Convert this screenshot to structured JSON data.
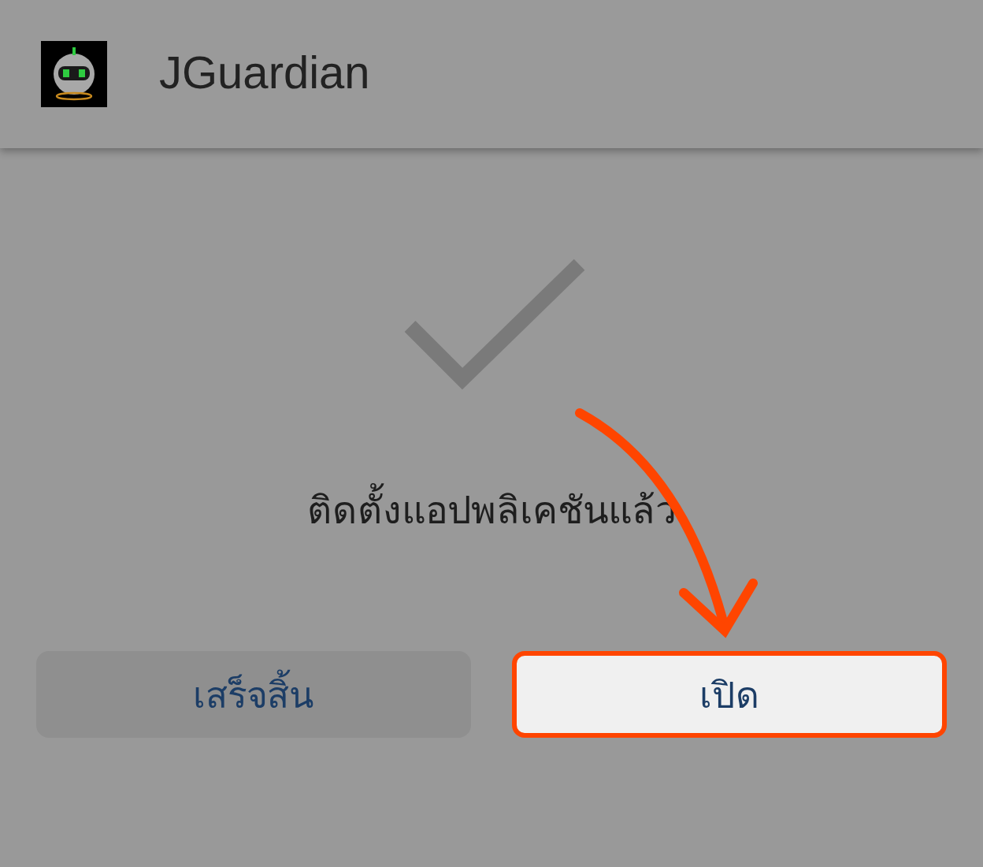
{
  "app_bar": {
    "title": "JGuardian"
  },
  "message": "ติดตั้งแอปพลิเคชันแล้ว",
  "buttons": [
    {
      "label": "เสร็จสิ้น",
      "highlighted": false
    },
    {
      "label": "เปิด",
      "highlighted": true
    }
  ]
}
